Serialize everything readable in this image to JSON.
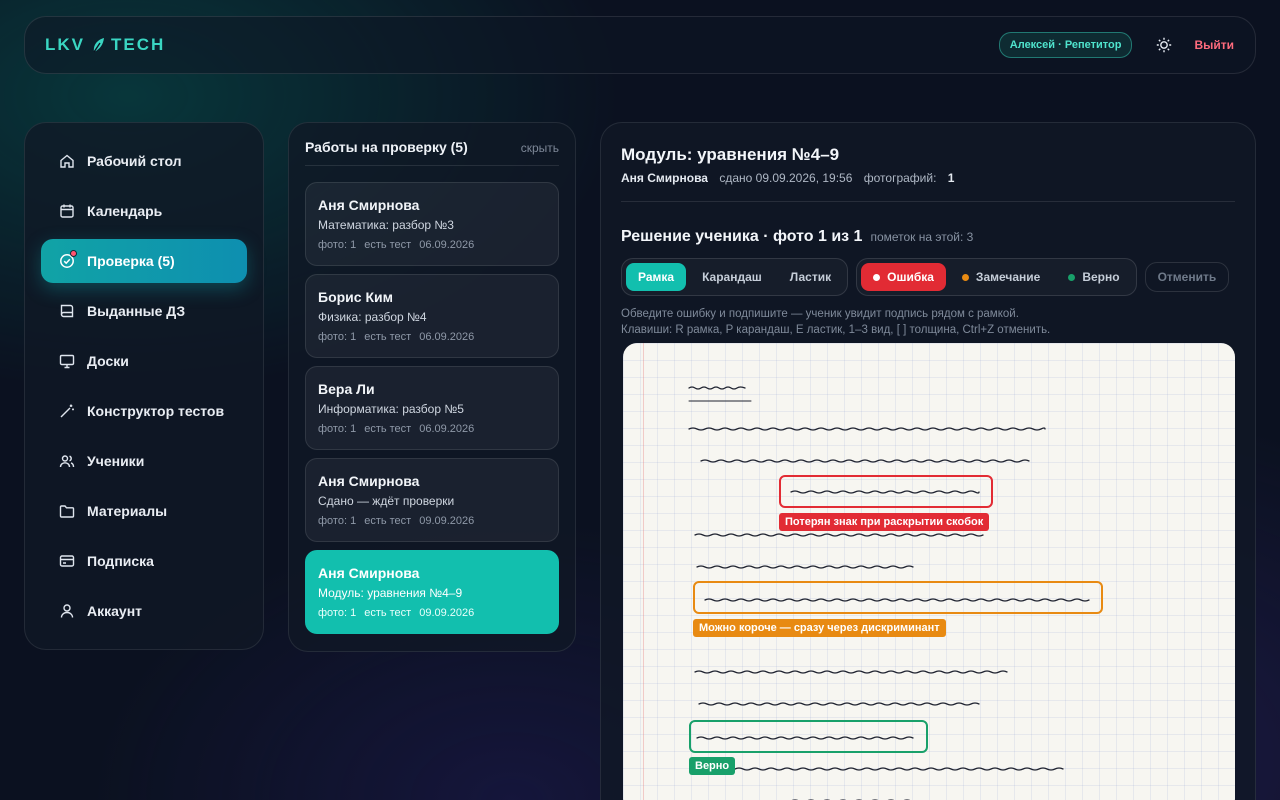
{
  "header": {
    "logo_left": "LKV",
    "logo_right": "TECH",
    "user_badge": "Алексей · Репетитор",
    "logout_label": "Выйти"
  },
  "sidebar": {
    "items": [
      {
        "label": "Рабочий стол",
        "icon": "home-icon"
      },
      {
        "label": "Календарь",
        "icon": "calendar-icon"
      },
      {
        "label": "Проверка (5)",
        "icon": "check-circle-icon",
        "active": true
      },
      {
        "label": "Выданные ДЗ",
        "icon": "book-icon"
      },
      {
        "label": "Доски",
        "icon": "monitor-icon"
      },
      {
        "label": "Конструктор тестов",
        "icon": "wand-icon"
      },
      {
        "label": "Ученики",
        "icon": "users-icon"
      },
      {
        "label": "Материалы",
        "icon": "folder-icon"
      },
      {
        "label": "Подписка",
        "icon": "card-icon"
      },
      {
        "label": "Аккаунт",
        "icon": "user-icon"
      }
    ]
  },
  "works": {
    "title": "Работы на проверку (5)",
    "hide_label": "скрыть",
    "cards": [
      {
        "name": "Аня Смирнова",
        "subject": "Математика: разбор №3",
        "photos": "фото: 1",
        "test": "есть тест",
        "date": "06.09.2026"
      },
      {
        "name": "Борис Ким",
        "subject": "Физика: разбор №4",
        "photos": "фото: 1",
        "test": "есть тест",
        "date": "06.09.2026"
      },
      {
        "name": "Вера Ли",
        "subject": "Информатика: разбор №5",
        "photos": "фото: 1",
        "test": "есть тест",
        "date": "06.09.2026"
      },
      {
        "name": "Аня Смирнова",
        "subject": "Сдано — ждёт проверки",
        "photos": "фото: 1",
        "test": "есть тест",
        "date": "09.09.2026"
      },
      {
        "name": "Аня Смирнова",
        "subject": "Модуль: уравнения №4–9",
        "photos": "фото: 1",
        "test": "есть тест",
        "date": "09.09.2026",
        "active": true
      }
    ]
  },
  "main": {
    "title": "Модуль: уравнения №4–9",
    "student": "Аня Смирнова",
    "submitted": "сдано 09.09.2026, 19:56",
    "photos_label": "фотографий:",
    "photos_count": "1",
    "solution_title": "Решение ученика · фото 1 из 1",
    "marks_count": "пометок на этой: 3",
    "tools": [
      "Рамка",
      "Карандаш",
      "Ластик"
    ],
    "mark_types": [
      {
        "label": "Ошибка",
        "color": "#e22b34"
      },
      {
        "label": "Замечание",
        "color": "#e88a12"
      },
      {
        "label": "Верно",
        "color": "#18a06a"
      }
    ],
    "undo_label": "Отменить",
    "hint_line1": "Обведите ошибку и подпишите — ученик увидит подпись рядом с рамкой.",
    "hint_line2": "Клавиши: R рамка, P карандаш, E ластик, 1–3 вид, [ ] толщина, Ctrl+Z отменить.",
    "annotations": [
      {
        "type": "error",
        "label": "Потерян знак при раскрытии скобок",
        "color": "#e22b34"
      },
      {
        "type": "remark",
        "label": "Можно короче — сразу через дискриминант",
        "color": "#e88a12"
      },
      {
        "type": "correct",
        "label": "Верно",
        "color": "#18a06a"
      }
    ]
  }
}
